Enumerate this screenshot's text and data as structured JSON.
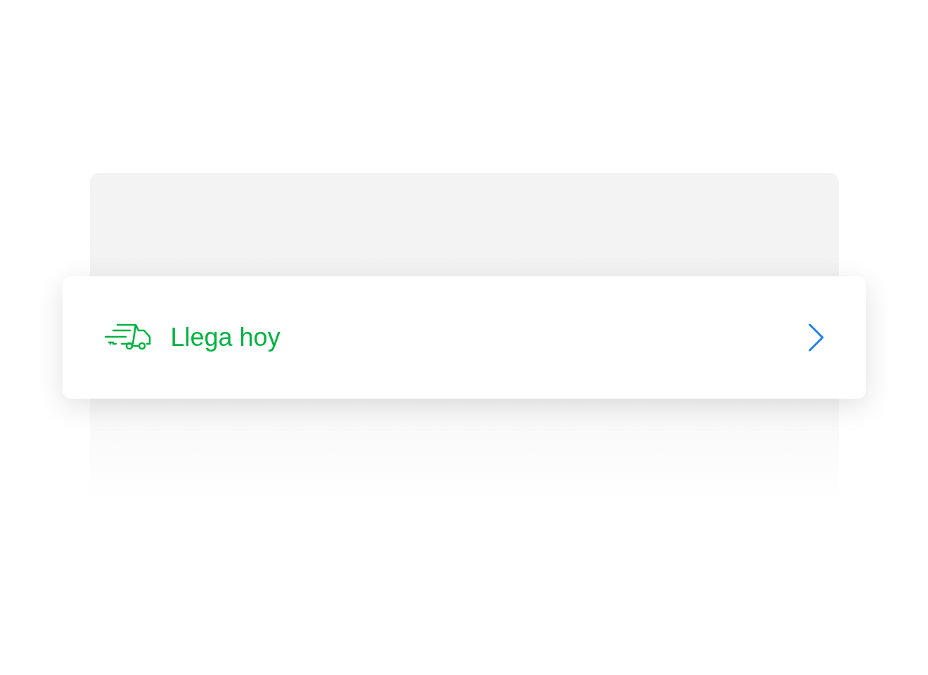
{
  "shipping_option": {
    "label": "Llega hoy"
  }
}
